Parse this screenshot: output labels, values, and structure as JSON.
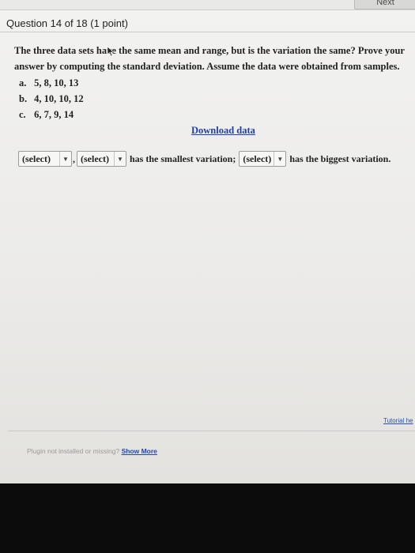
{
  "header": {
    "next_label": "Next",
    "question_counter": "Question 14 of 18 (1 point)"
  },
  "question": {
    "text": "The three data sets have the same mean and range, but is the variation the same? Prove your answer by computing the standard deviation. Assume the data were obtained from samples."
  },
  "datasets": [
    {
      "label": "a.",
      "values": "5, 8, 10, 13"
    },
    {
      "label": "b.",
      "values": "4, 10, 10, 12"
    },
    {
      "label": "c.",
      "values": "6, 7, 9, 14"
    }
  ],
  "download_link": "Download data",
  "answer": {
    "select1": "(select)",
    "separator": ",",
    "select2": "(select)",
    "text_mid": "has the smallest variation;",
    "select3": "(select)",
    "text_end": "has the biggest variation."
  },
  "footer": {
    "tutorial_link": "Tutorial he",
    "plugin_text": "Plugin not installed or missing?",
    "show_more": "Show More"
  },
  "colors": {
    "link": "#1f3fa8",
    "background": "#efefed",
    "bezel": "#0d0d0d"
  }
}
